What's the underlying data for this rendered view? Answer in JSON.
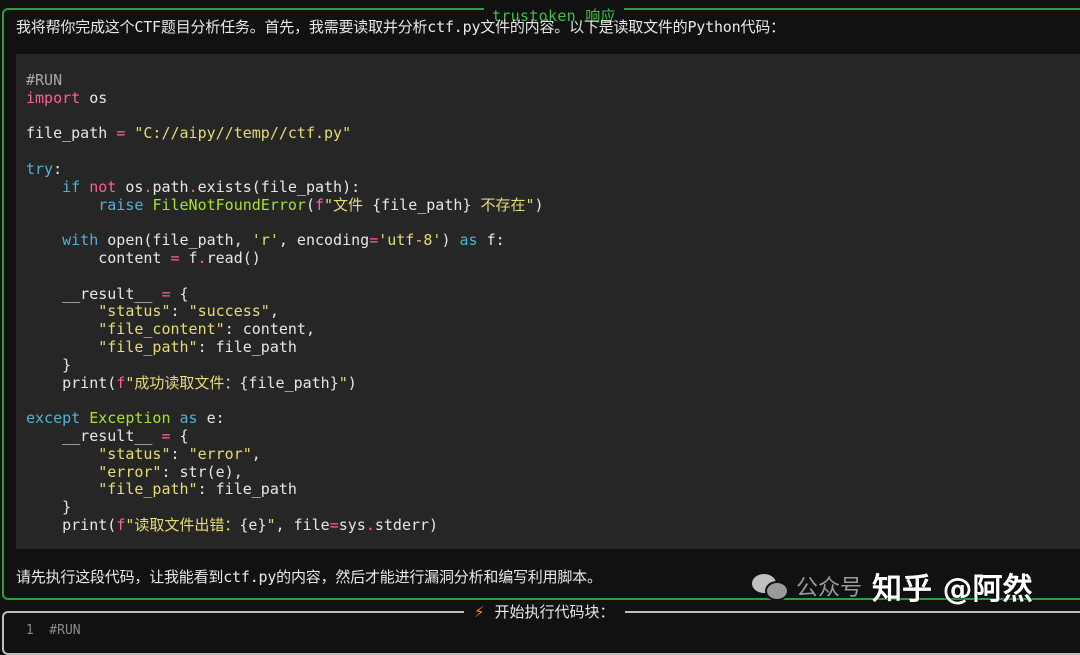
{
  "response_panel": {
    "title": "trustoken 响应",
    "intro": "我将帮你完成这个CTF题目分析任务。首先，我需要读取并分析ctf.py文件的内容。以下是读取文件的Python代码：",
    "outro": "请先执行这段代码，让我能看到ctf.py的内容，然后才能进行漏洞分析和编写利用脚本。"
  },
  "code": {
    "l01": "#RUN",
    "l02_kw": "import",
    "l02_rest": " os",
    "l04_a": "file_path ",
    "l04_op": "=",
    "l04_sp": " ",
    "l04_str": "\"C://aipy//temp//ctf.py\"",
    "l06_kw": "try",
    "l06_rest": ":",
    "l07_ind": "    ",
    "l07_kw1": "if",
    "l07_sp": " ",
    "l07_kw2": "not",
    "l07_rest1": " os",
    "l07_dot": ".",
    "l07_rest2": "path",
    "l07_dot2": ".",
    "l07_rest3": "exists(file_path):",
    "l08_ind": "        ",
    "l08_kw": "raise",
    "l08_sp": " ",
    "l08_fn": "FileNotFoundError",
    "l08_p1": "(",
    "l08_f": "f",
    "l08_str1": "\"文件 ",
    "l08_mid": "{file_path}",
    "l08_str2": " 不存在\"",
    "l08_p2": ")",
    "l10_ind": "    ",
    "l10_kw": "with",
    "l10_a": " open(file_path, ",
    "l10_s1": "'r'",
    "l10_b": ", encoding",
    "l10_op": "=",
    "l10_s2": "'utf-8'",
    "l10_c": ") ",
    "l10_kw2": "as",
    "l10_d": " f:",
    "l11_ind": "        ",
    "l11_a": "content ",
    "l11_op": "=",
    "l11_b": " f",
    "l11_dot": ".",
    "l11_c": "read()",
    "l13_ind": "    ",
    "l13_a": "__result__ ",
    "l13_op": "=",
    "l13_b": " {",
    "l14_ind": "        ",
    "l14_k": "\"status\"",
    "l14_a": ": ",
    "l14_v": "\"success\"",
    "l14_b": ",",
    "l15_ind": "        ",
    "l15_k": "\"file_content\"",
    "l15_a": ": content,",
    "l16_ind": "        ",
    "l16_k": "\"file_path\"",
    "l16_a": ": file_path",
    "l17": "    }",
    "l18_ind": "    ",
    "l18_a": "print(",
    "l18_f": "f",
    "l18_s1": "\"成功读取文件：",
    "l18_m": "{file_path}",
    "l18_s2": "\"",
    "l18_b": ")",
    "l20_kw": "except",
    "l20_sp": " ",
    "l20_fn": "Exception",
    "l20_sp2": " ",
    "l20_kw2": "as",
    "l20_a": " e:",
    "l21_ind": "    ",
    "l21_a": "__result__ ",
    "l21_op": "=",
    "l21_b": " {",
    "l22_ind": "        ",
    "l22_k": "\"status\"",
    "l22_a": ": ",
    "l22_v": "\"error\"",
    "l22_b": ",",
    "l23_ind": "        ",
    "l23_k": "\"error\"",
    "l23_a": ": str(e),",
    "l24_ind": "        ",
    "l24_k": "\"file_path\"",
    "l24_a": ": file_path",
    "l25": "    }",
    "l26_ind": "    ",
    "l26_a": "print(",
    "l26_f": "f",
    "l26_s1": "\"读取文件出错：",
    "l26_m": "{e}",
    "l26_s2": "\"",
    "l26_b": ", file",
    "l26_op": "=",
    "l26_c": "sys",
    "l26_dot": ".",
    "l26_d": "stderr)"
  },
  "watermark": {
    "platform": "公众号",
    "site": "知乎 @阿然"
  },
  "exec_panel": {
    "title": "开始执行代码块：",
    "first_line": " 1  #RUN"
  },
  "colors": {
    "panel_border": "#2f9e3a",
    "keyword": "#ff5fa0",
    "builtin_keyword": "#4fb1d6",
    "string": "#e6db74",
    "class_name": "#a6e22e"
  }
}
